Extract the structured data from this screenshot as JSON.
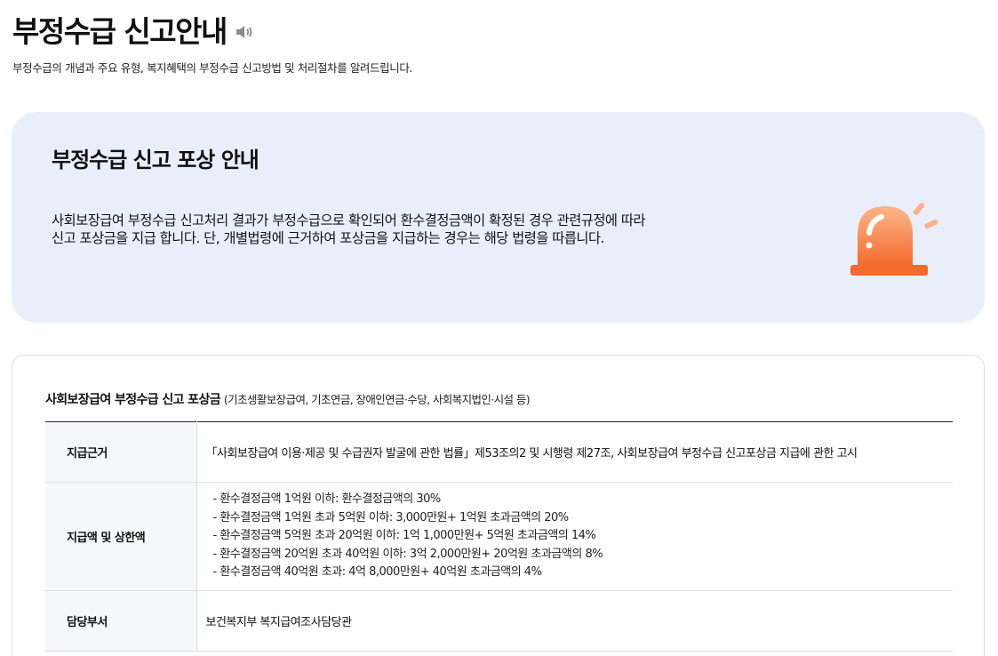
{
  "header": {
    "title": "부정수급 신고안내",
    "subtitle": "부정수급의 개념과 주요 유형, 복지혜택의 부정수급 신고방법 및 처리절차를 알려드립니다."
  },
  "notice": {
    "title": "부정수급 신고 포상 안내",
    "line1": "사회보장급여 부정수급 신고처리 결과가 부정수급으로 확인되어 환수결정금액이  확정된 경우 관련규정에 따라",
    "line2": "신고 포상금을 지급 합니다. 단, 개별법령에 근거하여 포상금을 지급하는 경우는 해당 법령을 따릅니다.",
    "icon": "siren-icon",
    "colors": {
      "background": "#e9eefb",
      "siren": "#f47a3f"
    }
  },
  "table": {
    "heading": "사회보장급여 부정수급 신고 포상금",
    "heading_sub": "(기초생활보장급여, 기초연금, 장애인연금·수당, 사회복지법인·시설 등)",
    "rows": [
      {
        "label": "지급근거",
        "value": "「사회보장급여 이용·제공 및 수급권자 발굴에 관한 법률」제53조의2 및 시행령 제27조, 사회보장급여 부정수급 신고포상금 지급에 관한 고시"
      },
      {
        "label": "지급액 및 상한액",
        "items": [
          "- 환수결정금액 1억원 이하: 환수결정금액의 30%",
          "- 환수결정금액 1억원 초과 5억원 이하: 3,000만원+ 1억원 초과금액의 20%",
          "- 환수결정금액 5억원 초과 20억원 이하: 1억 1,000만원+ 5억원 초과금액의 14%",
          "- 환수결정금액 20억원 초과 40억원 이하: 3억 2,000만원+ 20억원 초과금액의 8%",
          "- 환수결정금액 40억원 초과: 4억 8,000만원+ 40억원 초과금액의 4%"
        ]
      },
      {
        "label": "담당부서",
        "value": "보건복지부 복지급여조사담당관"
      }
    ]
  }
}
